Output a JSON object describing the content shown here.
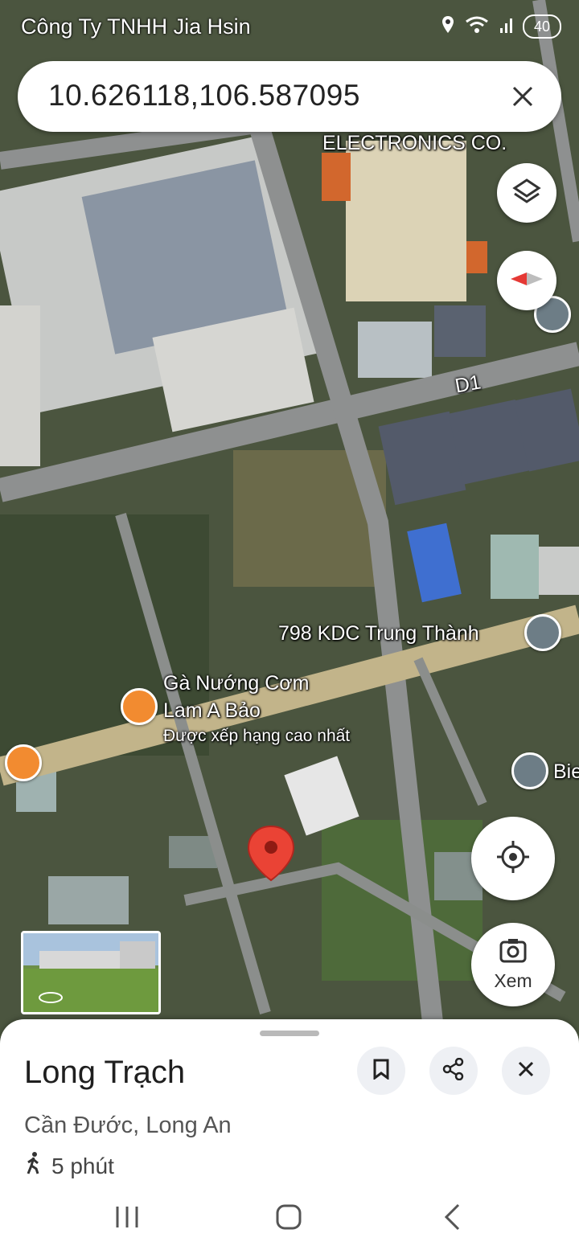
{
  "status_bar": {
    "title": "Công Ty TNHH Jia Hsin",
    "battery": "40",
    "icons": [
      "location-icon",
      "wifi-icon",
      "signal-icon",
      "battery-icon"
    ]
  },
  "search": {
    "value": "10.626118,106.587095",
    "clear_icon": "close-icon"
  },
  "map": {
    "labels": {
      "electronics": "ELECTRONICS CO.",
      "road_d1": "D1",
      "kdc": "798 KDC Trung Thành",
      "restaurant_name_line1": "Gà Nướng Cơm",
      "restaurant_name_line2": "Lam A Bảo",
      "restaurant_rating": "Được xếp hạng cao nhất",
      "edge_label": "Bie"
    },
    "colors": {
      "pin_red": "#ea4335",
      "poi_orange": "#f28b30",
      "poi_gray": "#6d7d86"
    }
  },
  "controls": {
    "layers_icon": "layers-icon",
    "compass_icon": "compass-icon",
    "location_icon": "my-location-icon",
    "xem_label": "Xem",
    "xem_icon": "camera-icon"
  },
  "sheet": {
    "title": "Long Trạch",
    "address": "Cần Đước, Long An",
    "walk_time": "5 phút",
    "walk_icon": "walking-icon",
    "actions": [
      "bookmark-icon",
      "share-icon",
      "close-icon"
    ]
  },
  "navbar": {
    "icons": [
      "recent-apps-icon",
      "home-icon",
      "back-icon"
    ]
  }
}
